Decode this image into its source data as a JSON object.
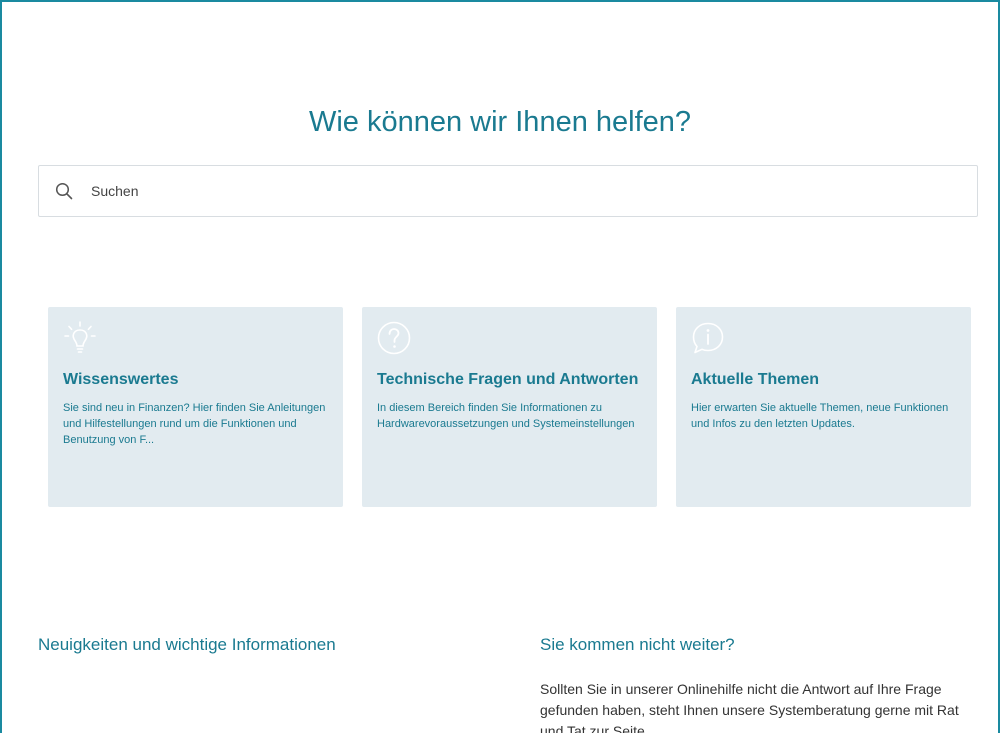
{
  "page": {
    "title": "Wie können wir Ihnen helfen?"
  },
  "search": {
    "placeholder": "Suchen",
    "icon": "search-icon"
  },
  "cards": [
    {
      "icon": "lightbulb-icon",
      "title": "Wissenswertes",
      "text": "Sie sind neu in Finanzen? Hier finden Sie Anleitungen und Hilfestellungen rund um die Funktionen und Benutzung von F..."
    },
    {
      "icon": "question-circle-icon",
      "title": "Technische Fragen und Antworten",
      "text": "In diesem Bereich finden Sie Informationen zu Hardwarevoraussetzungen und Systemeinstellungen"
    },
    {
      "icon": "info-speech-bubble-icon",
      "title": "Aktuelle Themen",
      "text": "Hier erwarten Sie aktuelle Themen, neue Funktionen und Infos zu den letzten Updates."
    }
  ],
  "news": {
    "heading": "Neuigkeiten und wichtige Informationen"
  },
  "help": {
    "heading": "Sie kommen nicht weiter?",
    "text": "Sollten Sie in unserer Onlinehilfe nicht die Antwort auf Ihre Frage gefunden haben, steht Ihnen unsere Systemberatung gerne mit Rat und Tat zur Seite."
  },
  "colors": {
    "accent": "#1a7a90",
    "frame_border": "#1a8aa0",
    "card_background": "#e2ebf0"
  }
}
